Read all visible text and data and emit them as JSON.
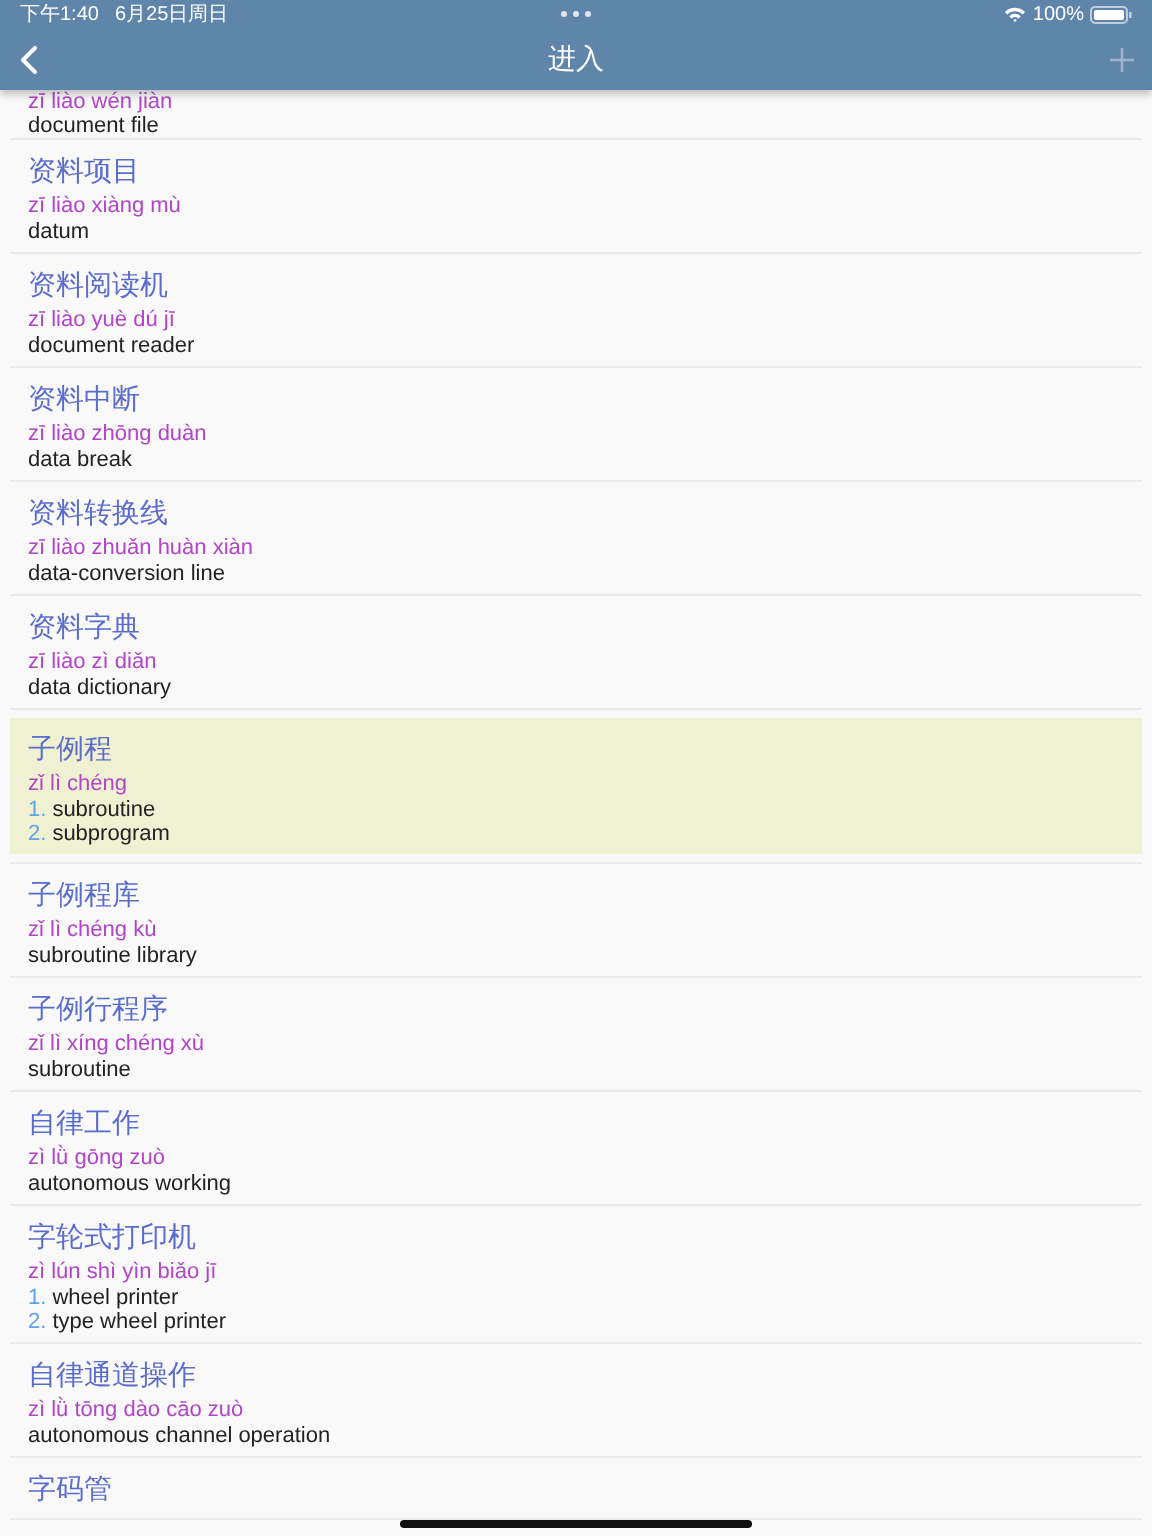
{
  "status_bar": {
    "time": "下午1:40",
    "date": "6月25日周日",
    "battery": "100%"
  },
  "nav_bar": {
    "title": "进入"
  },
  "entries": [
    {
      "pinyin": "zī liào wén jiàn",
      "definitions": [
        {
          "text": "document file"
        }
      ],
      "selected": false
    },
    {
      "headword": "资料项目",
      "pinyin": "zī liào xiàng mù",
      "definitions": [
        {
          "text": "datum"
        }
      ],
      "selected": false
    },
    {
      "headword": "资料阅读机",
      "pinyin": "zī liào yuè dú jī",
      "definitions": [
        {
          "text": "document reader"
        }
      ],
      "selected": false
    },
    {
      "headword": "资料中断",
      "pinyin": "zī liào zhōng duàn",
      "definitions": [
        {
          "text": "data break"
        }
      ],
      "selected": false
    },
    {
      "headword": "资料转换线",
      "pinyin": "zī liào zhuǎn huàn xiàn",
      "definitions": [
        {
          "text": "data-conversion line"
        }
      ],
      "selected": false
    },
    {
      "headword": "资料字典",
      "pinyin": "zī liào zì diǎn",
      "definitions": [
        {
          "text": "data dictionary"
        }
      ],
      "selected": false
    },
    {
      "headword": "子例程",
      "pinyin": "zǐ lì chéng",
      "definitions": [
        {
          "number": "1.",
          "text": "subroutine"
        },
        {
          "number": "2.",
          "text": "subprogram"
        }
      ],
      "selected": true
    },
    {
      "headword": "子例程库",
      "pinyin": "zǐ lì chéng kù",
      "definitions": [
        {
          "text": "subroutine library"
        }
      ],
      "selected": false
    },
    {
      "headword": "子例行程序",
      "pinyin": "zǐ lì xíng chéng xù",
      "definitions": [
        {
          "text": "subroutine"
        }
      ],
      "selected": false
    },
    {
      "headword": "自律工作",
      "pinyin": "zì lǜ gōng zuò",
      "definitions": [
        {
          "text": "autonomous working"
        }
      ],
      "selected": false
    },
    {
      "headword": "字轮式打印机",
      "pinyin": "zì lún shì yìn biǎo jī",
      "definitions": [
        {
          "number": "1.",
          "text": "wheel printer"
        },
        {
          "number": "2.",
          "text": "type wheel printer"
        }
      ],
      "selected": false
    },
    {
      "headword": "自律通道操作",
      "pinyin": "zì lǜ tōng dào cāo zuò",
      "definitions": [
        {
          "text": "autonomous channel operation"
        }
      ],
      "selected": false
    },
    {
      "headword": "字码管",
      "selected": false
    }
  ]
}
